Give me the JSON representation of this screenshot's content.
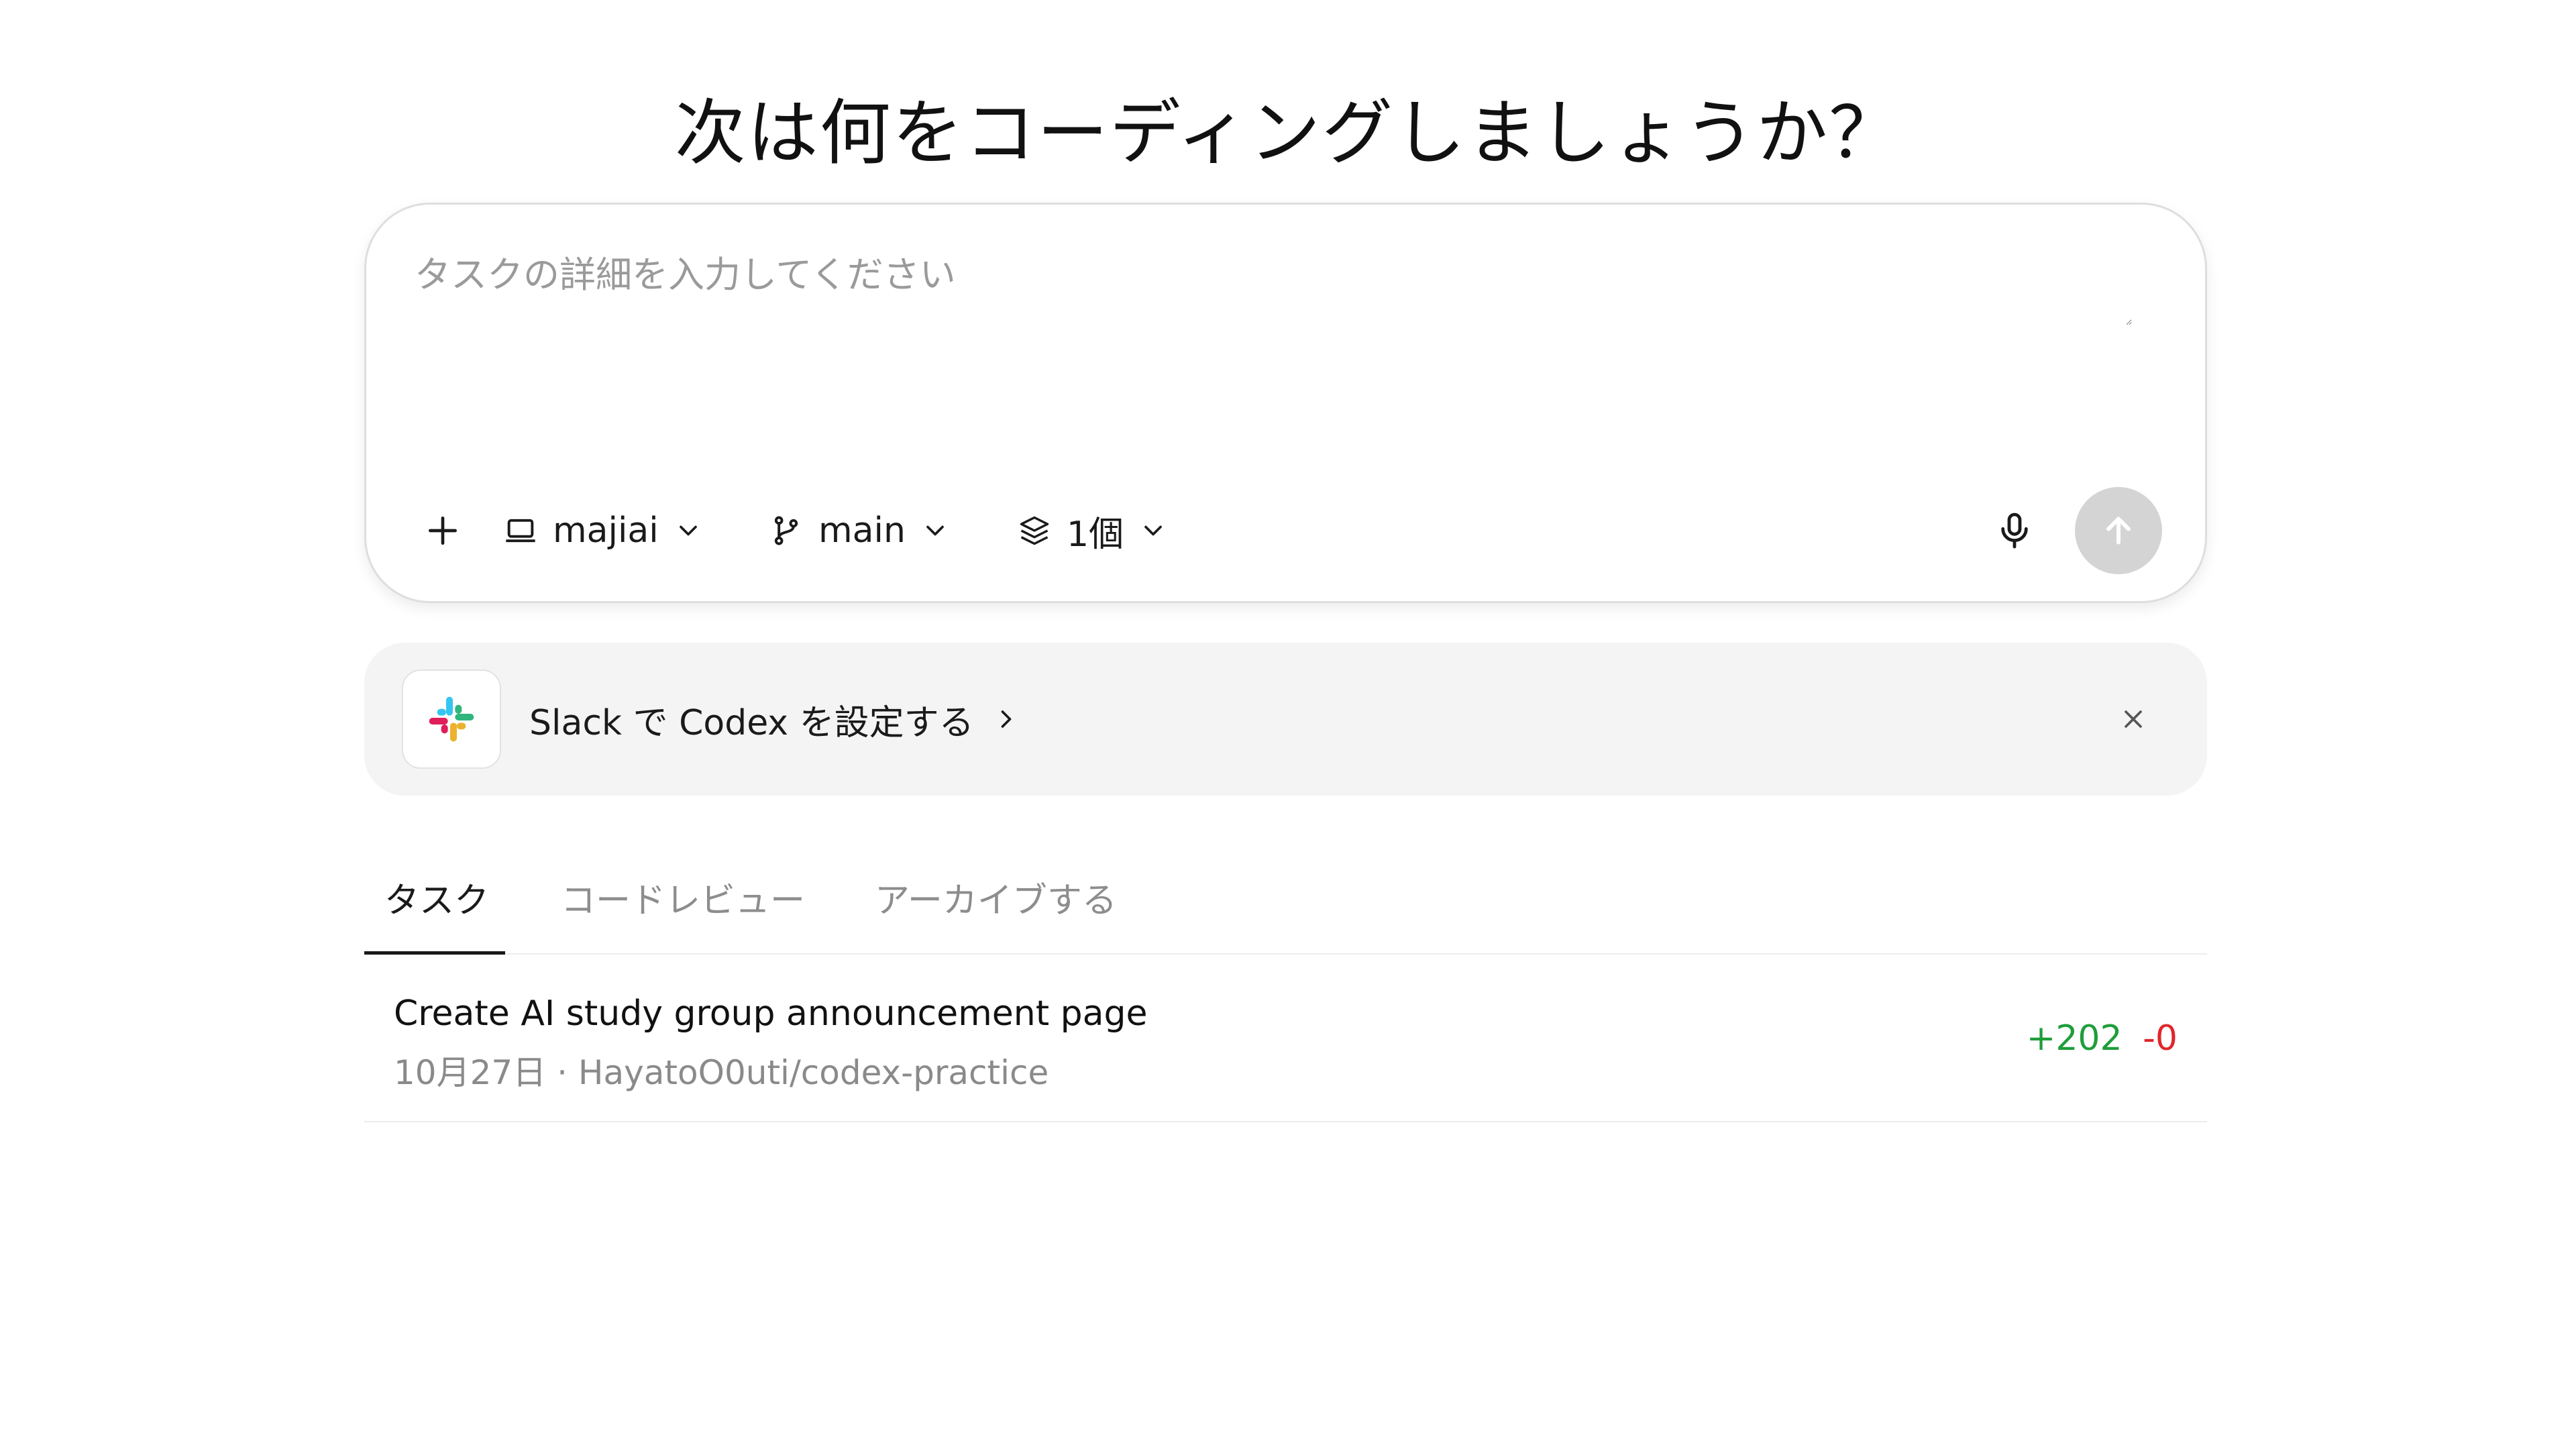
{
  "headline": "次は何をコーディングしましょうか？",
  "composer": {
    "placeholder": "タスクの詳細を入力してください",
    "environment": "majiai",
    "branch": "main",
    "versions": "1個"
  },
  "banner": {
    "text": "Slack で Codex を設定する"
  },
  "tabs": [
    {
      "label": "タスク",
      "active": true
    },
    {
      "label": "コードレビュー",
      "active": false
    },
    {
      "label": "アーカイブする",
      "active": false
    }
  ],
  "tasks": [
    {
      "title": "Create AI study group announcement page",
      "meta": "10月27日 · HayatoO0uti/codex-practice",
      "additions": "+202",
      "deletions": "-0"
    }
  ],
  "colors": {
    "additions": "#1f9d3a",
    "deletions": "#e0262b",
    "send_button_disabled": "#d4d4d4",
    "banner_bg": "#f4f4f4"
  },
  "icons": [
    "plus-icon",
    "laptop-icon",
    "chevron-down-icon",
    "git-branch-icon",
    "stack-icon",
    "microphone-icon",
    "arrow-up-icon",
    "slack-logo",
    "chevron-right-icon",
    "close-icon"
  ]
}
